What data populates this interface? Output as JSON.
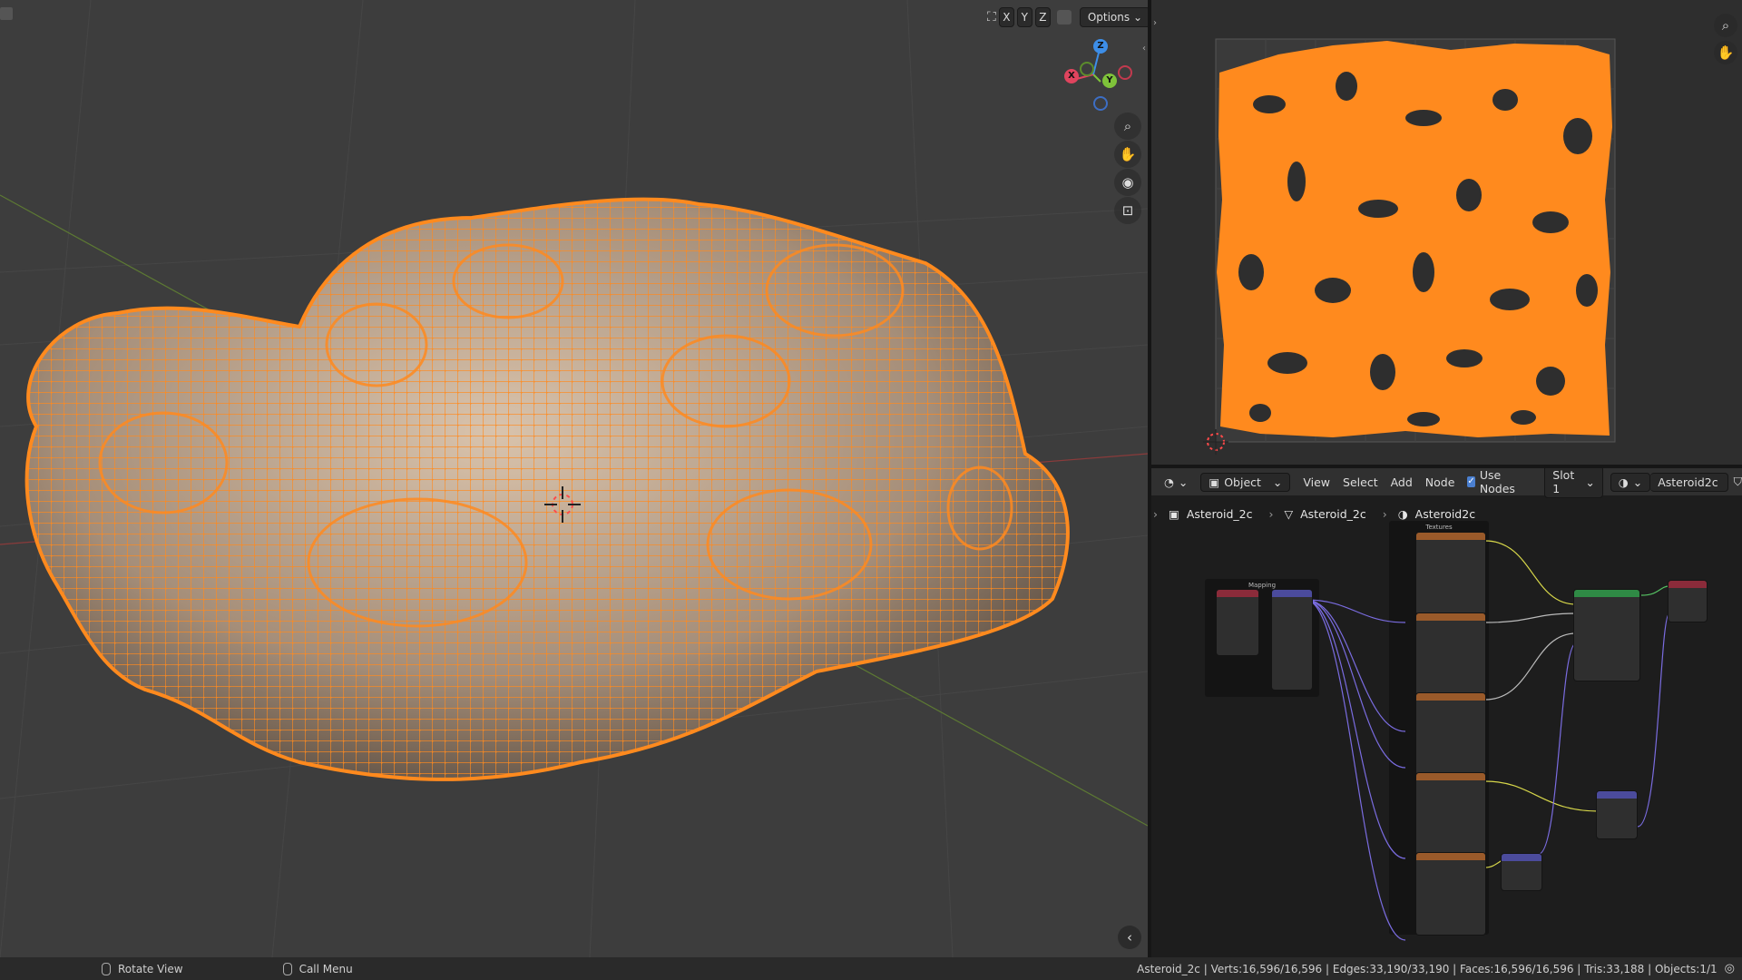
{
  "viewport": {
    "axis_x": "X",
    "axis_y": "Y",
    "axis_z": "Z",
    "options_label": "Options",
    "gizmo": {
      "x": "X",
      "y": "Y",
      "z": "Z"
    },
    "icons": [
      "zoom-icon",
      "hand-pan-icon",
      "camera-icon",
      "lock-icon"
    ]
  },
  "node_editor": {
    "header": {
      "mode": "Object",
      "menu": [
        "View",
        "Select",
        "Add",
        "Node"
      ],
      "use_nodes_label": "Use Nodes",
      "use_nodes_checked": true,
      "slot": "Slot 1",
      "material": "Asteroid2c"
    },
    "breadcrumb": [
      "Asteroid_2c",
      "Asteroid_2c",
      "Asteroid2c"
    ],
    "frames": {
      "mapping": "Mapping",
      "textures": "Textures"
    }
  },
  "status_bar": {
    "left_action": "Rotate View",
    "middle_action": "Call Menu",
    "stats": "Asteroid_2c | Verts:16,596/16,596 | Edges:33,190/33,190 | Faces:16,596/16,596 | Tris:33,188 | Objects:1/1"
  },
  "colors": {
    "accent_orange": "#ff8a1e",
    "viewport_bg": "#3d3d3d",
    "node_bg": "#1d1d1d"
  }
}
